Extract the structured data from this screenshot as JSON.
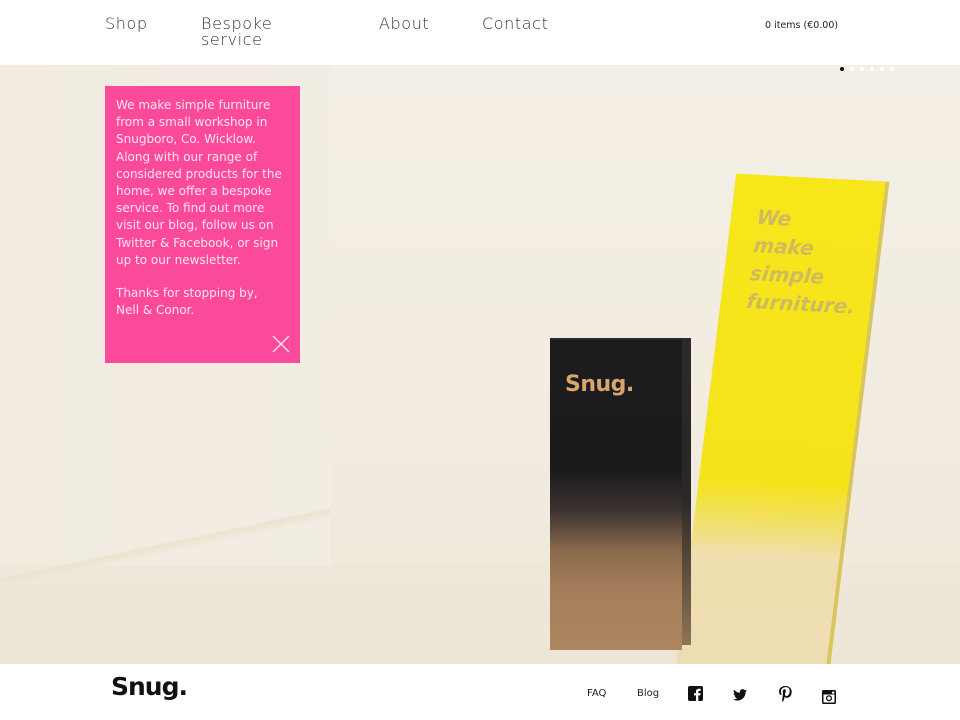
{
  "header": {
    "nav": [
      {
        "label": "Shop"
      },
      {
        "label": "Bespoke service"
      },
      {
        "label": "About"
      },
      {
        "label": "Contact"
      }
    ],
    "cart_label": "0 items (€0.00)"
  },
  "hero": {
    "slider": {
      "total_slides": 6,
      "active_index": 0
    },
    "intro_box": {
      "paragraph1": "We make simple furniture from a small workshop in Snugboro, Co. Wicklow. Along with our range of considered products for the home, we offer a bespoke service. To find out more visit our blog, follow us on Twitter & Facebook, or sign up to our newsletter.",
      "paragraph2_line1": "Thanks for stopping by,",
      "paragraph2_line2": "Nell & Conor.",
      "close_icon": "close-icon",
      "background_color": "#fb4a9b"
    },
    "photo": {
      "board_text": [
        "We",
        "make",
        "simple",
        "furniture."
      ],
      "block_logo": "Snug."
    }
  },
  "footer": {
    "logo": "Snug.",
    "links": [
      {
        "label": "FAQ"
      },
      {
        "label": "Blog"
      }
    ],
    "social": [
      "facebook-icon",
      "twitter-icon",
      "pinterest-icon",
      "instagram-icon"
    ]
  }
}
